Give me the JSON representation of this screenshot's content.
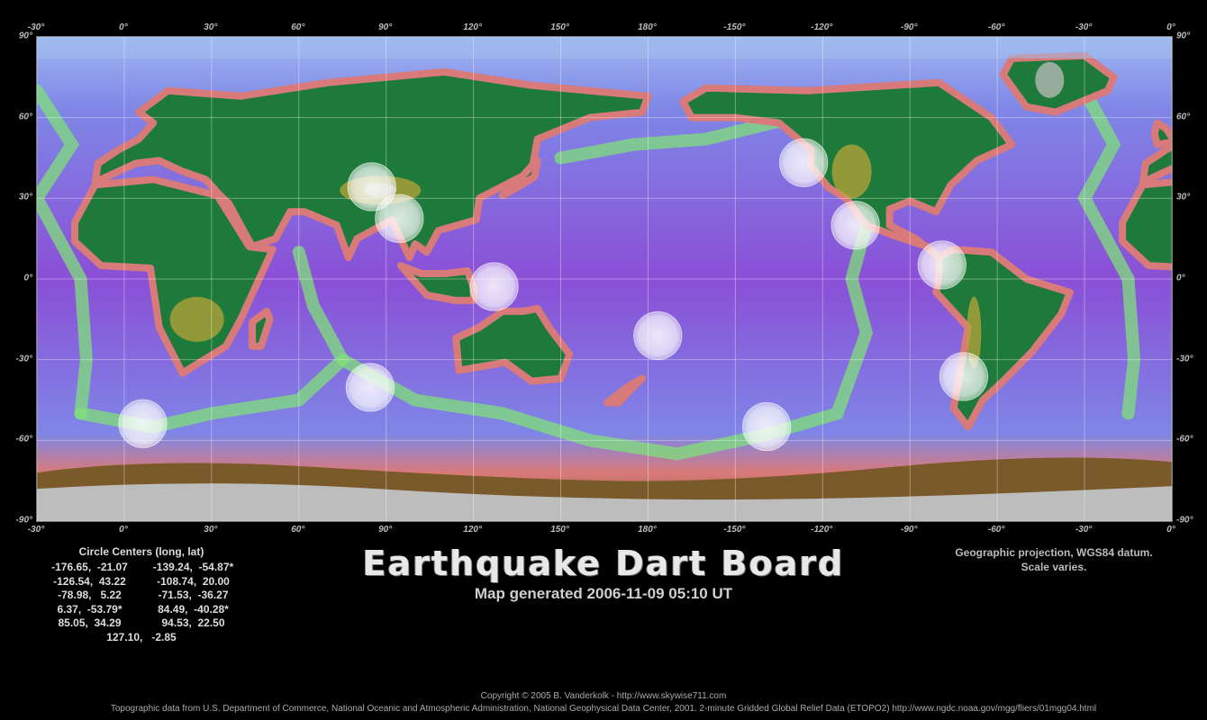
{
  "map": {
    "lon_ticks": [
      "-30°",
      "0°",
      "30°",
      "60°",
      "90°",
      "120°",
      "150°",
      "180°",
      "-150°",
      "-120°",
      "-90°",
      "-60°",
      "-30°",
      "0°",
      "30°"
    ],
    "lat_ticks": [
      "90°",
      "60°",
      "30°",
      "0°",
      "-30°",
      "-60°",
      "-90°"
    ],
    "circles": [
      {
        "lon": -176.65,
        "lat": -21.07
      },
      {
        "lon": -139.24,
        "lat": -54.87
      },
      {
        "lon": -126.54,
        "lat": 43.22
      },
      {
        "lon": -108.74,
        "lat": 20.0
      },
      {
        "lon": -78.98,
        "lat": 5.22
      },
      {
        "lon": -71.53,
        "lat": -36.27
      },
      {
        "lon": 6.37,
        "lat": -53.79
      },
      {
        "lon": 84.49,
        "lat": -40.28
      },
      {
        "lon": 85.05,
        "lat": 34.29
      },
      {
        "lon": 94.53,
        "lat": 22.5
      },
      {
        "lon": 127.1,
        "lat": -2.85
      }
    ],
    "colors": {
      "deep_ocean": "#8a4fd6",
      "ocean": "#7f86e6",
      "ridge": "#7fe07a",
      "shelf": "#d97a7a",
      "lowland": "#1e7a3a",
      "highland": "#b9a43a",
      "ice": "#bdbdbd"
    }
  },
  "centers": {
    "title": "Circle Centers (long, lat)",
    "rows": [
      [
        "-176.65,  -21.07",
        "-139.24,  -54.87*"
      ],
      [
        "-126.54,  43.22",
        "-108.74,  20.00"
      ],
      [
        "-78.98,   5.22",
        "-71.53,  -36.27"
      ],
      [
        "6.37,  -53.79*",
        "84.49,  -40.28*"
      ],
      [
        "85.05,  34.29",
        "94.53,  22.50"
      ],
      [
        "127.10,   -2.85",
        ""
      ]
    ]
  },
  "title": "Earthquake Dart Board",
  "subtitle": "Map generated 2006-11-09 05:10 UT",
  "projection": [
    "Geographic projection, WGS84 datum.",
    "Scale varies."
  ],
  "footer": [
    "Copyright © 2005 B. Vanderkolk - http://www.skywise711.com",
    "Topographic data from U.S. Department of Commerce, National Oceanic and Atmospheric Administration, National Geophysical Data Center, 2001. 2-minute Gridded Global Relief Data (ETOPO2) http://www.ngdc.noaa.gov/mgg/fliers/01mgg04.html"
  ]
}
